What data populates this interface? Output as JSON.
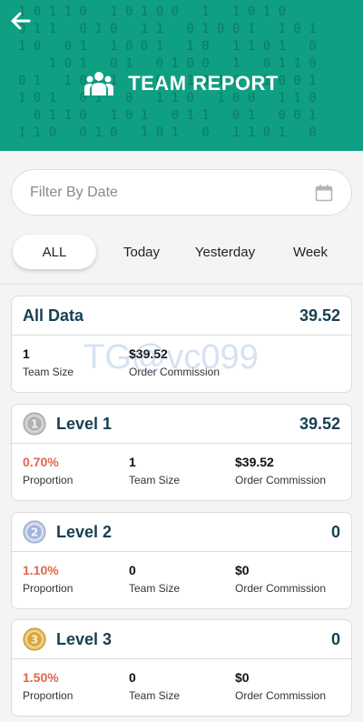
{
  "header": {
    "title": "TEAM REPORT"
  },
  "filter": {
    "placeholder": "Filter By Date"
  },
  "tabs": [
    {
      "label": "ALL"
    },
    {
      "label": "Today"
    },
    {
      "label": "Yesterday"
    },
    {
      "label": "Week"
    }
  ],
  "watermark": "TG@vc099",
  "all_data": {
    "title": "All Data",
    "total": "39.52",
    "team_size": "1",
    "team_size_label": "Team Size",
    "commission": "$39.52",
    "commission_label": "Order Commission"
  },
  "levels": [
    {
      "name": "Level 1",
      "total": "39.52",
      "proportion": "0.70%",
      "proportion_label": "Proportion",
      "team_size": "1",
      "team_size_label": "Team Size",
      "commission": "$39.52",
      "commission_label": "Order Commission",
      "medal_digit": "1",
      "medal_color": "#a8a8a8"
    },
    {
      "name": "Level 2",
      "total": "0",
      "proportion": "1.10%",
      "proportion_label": "Proportion",
      "team_size": "0",
      "team_size_label": "Team Size",
      "commission": "$0",
      "commission_label": "Order Commission",
      "medal_digit": "2",
      "medal_color": "#9aaad6"
    },
    {
      "name": "Level 3",
      "total": "0",
      "proportion": "1.50%",
      "proportion_label": "Proportion",
      "team_size": "0",
      "team_size_label": "Team Size",
      "commission": "$0",
      "commission_label": "Order Commission",
      "medal_digit": "3",
      "medal_color": "#d9a63d"
    }
  ],
  "colors": {
    "header_bg": "#0f9f83",
    "title_text": "#173f54",
    "proportion": "#e0674c"
  }
}
